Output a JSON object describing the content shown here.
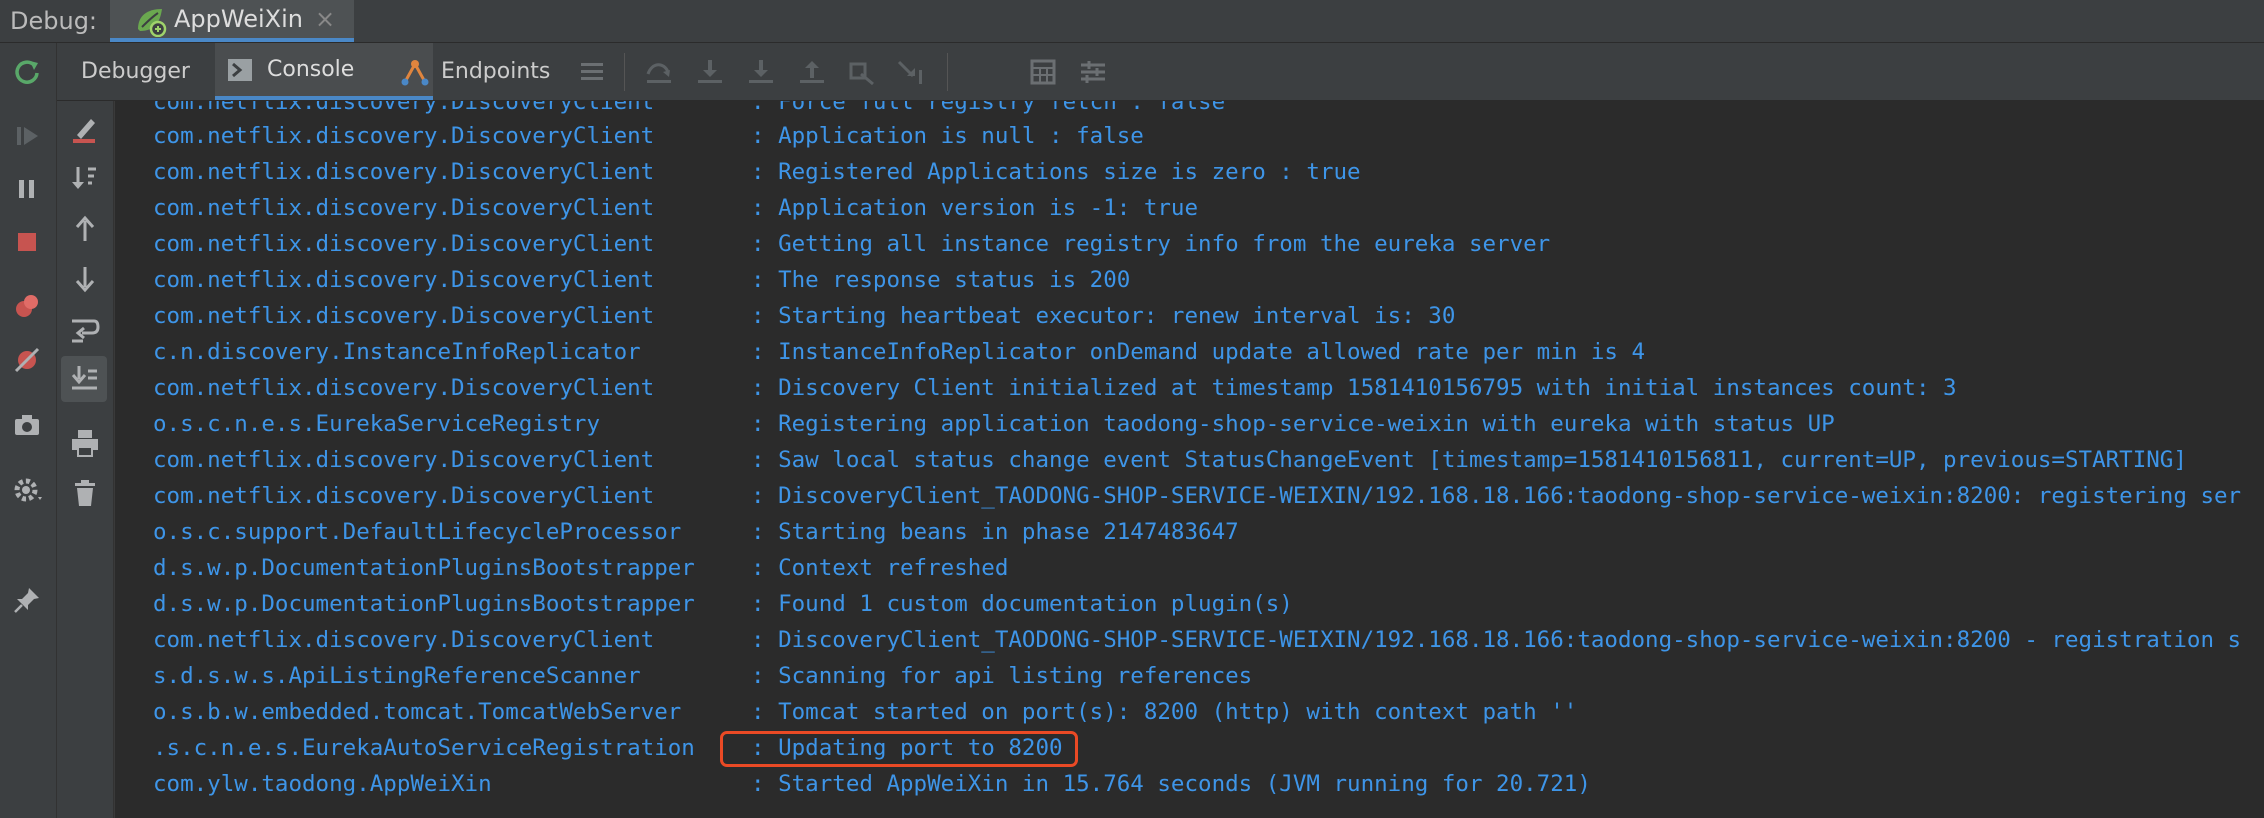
{
  "window": {
    "debug_label": "Debug:",
    "run_tab_label": "AppWeiXin",
    "run_tab_close": "×"
  },
  "toolbar": {
    "tabs": [
      {
        "label": "Debugger"
      },
      {
        "label": "Console",
        "selected": true
      },
      {
        "label": "Endpoints"
      }
    ]
  },
  "colors": {
    "log_text": "#3e95e8",
    "highlight": "#ea4a25",
    "background": "#2b2b2b",
    "panel": "#3c3f41"
  },
  "icons": {
    "left_toolbar": [
      "rerun-icon",
      "resume-icon",
      "pause-icon",
      "stop-icon",
      "view-breakpoints-icon",
      "mute-breakpoints-icon",
      "camera-icon",
      "settings-icon",
      "pin-icon"
    ],
    "console_toolbar": [
      "clear-all-icon",
      "sort-icon",
      "scroll-up-icon",
      "scroll-down-icon",
      "soft-wrap-icon",
      "scroll-to-end-icon",
      "print-icon",
      "trash-icon"
    ],
    "top_toolbar": [
      "layout-icon",
      "step-over-icon",
      "step-into-icon",
      "force-step-into-icon",
      "step-out-icon",
      "drop-frame-icon",
      "run-to-cursor-icon",
      "evaluate-icon",
      "trace-icon"
    ]
  },
  "console": {
    "lines": [
      {
        "logger": "com.netflix.discovery.DiscoveryClient",
        "message": "Force full registry fetch : false"
      },
      {
        "logger": "com.netflix.discovery.DiscoveryClient",
        "message": "Application is null : false"
      },
      {
        "logger": "com.netflix.discovery.DiscoveryClient",
        "message": "Registered Applications size is zero : true"
      },
      {
        "logger": "com.netflix.discovery.DiscoveryClient",
        "message": "Application version is -1: true"
      },
      {
        "logger": "com.netflix.discovery.DiscoveryClient",
        "message": "Getting all instance registry info from the eureka server"
      },
      {
        "logger": "com.netflix.discovery.DiscoveryClient",
        "message": "The response status is 200"
      },
      {
        "logger": "com.netflix.discovery.DiscoveryClient",
        "message": "Starting heartbeat executor: renew interval is: 30"
      },
      {
        "logger": "c.n.discovery.InstanceInfoReplicator",
        "message": "InstanceInfoReplicator onDemand update allowed rate per min is 4"
      },
      {
        "logger": "com.netflix.discovery.DiscoveryClient",
        "message": "Discovery Client initialized at timestamp 1581410156795 with initial instances count: 3"
      },
      {
        "logger": "o.s.c.n.e.s.EurekaServiceRegistry",
        "message": "Registering application taodong-shop-service-weixin with eureka with status UP"
      },
      {
        "logger": "com.netflix.discovery.DiscoveryClient",
        "message": "Saw local status change event StatusChangeEvent [timestamp=1581410156811, current=UP, previous=STARTING]"
      },
      {
        "logger": "com.netflix.discovery.DiscoveryClient",
        "message": "DiscoveryClient_TAODONG-SHOP-SERVICE-WEIXIN/192.168.18.166:taodong-shop-service-weixin:8200: registering ser"
      },
      {
        "logger": "o.s.c.support.DefaultLifecycleProcessor",
        "message": "Starting beans in phase 2147483647"
      },
      {
        "logger": "d.s.w.p.DocumentationPluginsBootstrapper",
        "message": "Context refreshed"
      },
      {
        "logger": "d.s.w.p.DocumentationPluginsBootstrapper",
        "message": "Found 1 custom documentation plugin(s)"
      },
      {
        "logger": "com.netflix.discovery.DiscoveryClient",
        "message": "DiscoveryClient_TAODONG-SHOP-SERVICE-WEIXIN/192.168.18.166:taodong-shop-service-weixin:8200 - registration s"
      },
      {
        "logger": "s.d.s.w.s.ApiListingReferenceScanner",
        "message": "Scanning for api listing references"
      },
      {
        "logger": "o.s.b.w.embedded.tomcat.TomcatWebServer",
        "message": "Tomcat started on port(s): 8200 (http) with context path ''"
      },
      {
        "logger": ".s.c.n.e.s.EurekaAutoServiceRegistration",
        "message": "Updating port to 8200",
        "highlighted": true
      },
      {
        "logger": "com.ylw.taodong.AppWeiXin",
        "message": "Started AppWeiXin in 15.764 seconds (JVM running for 20.721)"
      }
    ]
  }
}
